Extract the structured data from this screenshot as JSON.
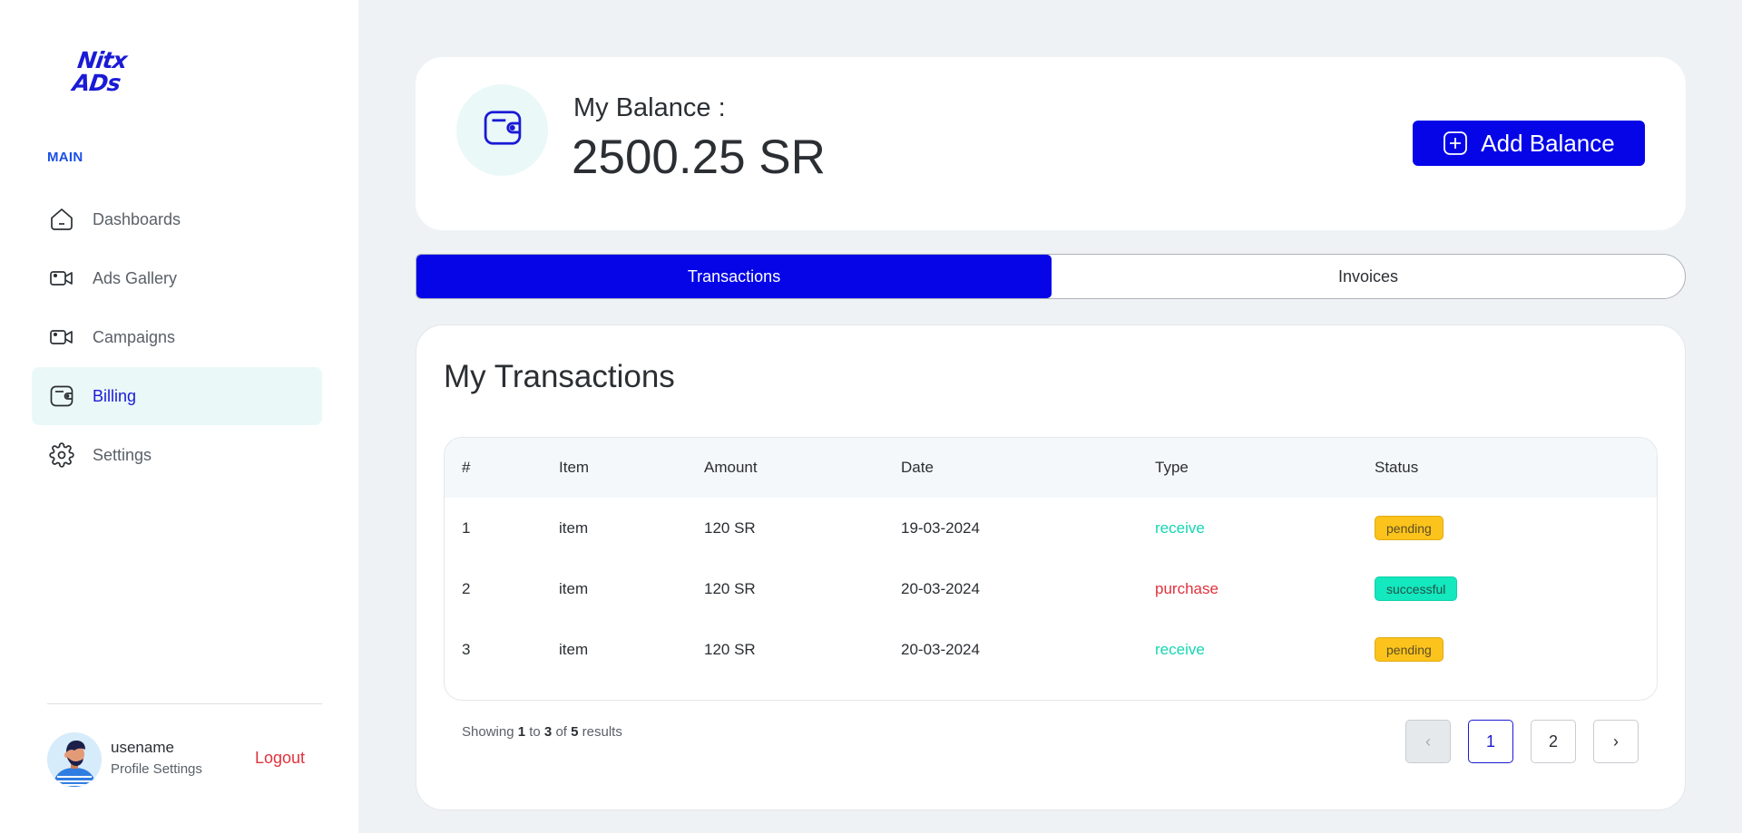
{
  "brand": {
    "logo_line1": "Nitx",
    "logo_line2": "ADs",
    "color": "#1a1ad6"
  },
  "sidebar": {
    "section_label": "MAIN",
    "items": [
      {
        "label": "Dashboards",
        "icon": "home-icon",
        "active": false
      },
      {
        "label": "Ads Gallery",
        "icon": "video-icon",
        "active": false
      },
      {
        "label": "Campaigns",
        "icon": "video-icon",
        "active": false
      },
      {
        "label": "Billing",
        "icon": "wallet-icon",
        "active": true
      },
      {
        "label": "Settings",
        "icon": "gear-icon",
        "active": false
      }
    ],
    "user": {
      "name": "usename",
      "sub_link": "Profile Settings",
      "logout": "Logout"
    }
  },
  "balance": {
    "label": "My Balance :",
    "value": "2500.25 SR",
    "add_button": "Add Balance"
  },
  "tabs": [
    {
      "label": "Transactions",
      "active": true
    },
    {
      "label": "Invoices",
      "active": false
    }
  ],
  "transactions": {
    "title": "My Transactions",
    "columns": [
      "#",
      "Item",
      "Amount",
      "Date",
      "Type",
      "Status"
    ],
    "rows": [
      {
        "idx": "1",
        "item": "item",
        "amount": "120 SR",
        "date": "19-03-2024",
        "type": "receive",
        "status": "pending"
      },
      {
        "idx": "2",
        "item": "item",
        "amount": "120 SR",
        "date": "20-03-2024",
        "type": "purchase",
        "status": "successful"
      },
      {
        "idx": "3",
        "item": "item",
        "amount": "120 SR",
        "date": "20-03-2024",
        "type": "receive",
        "status": "pending"
      }
    ],
    "footer": {
      "prefix": "Showing",
      "from": "1",
      "to_word": "to",
      "to": "3",
      "of_word": "of",
      "total": "5",
      "suffix": "results"
    },
    "pagination": {
      "prev": "‹",
      "pages": [
        "1",
        "2"
      ],
      "current": "1",
      "next": "›"
    }
  },
  "colors": {
    "accent": "#0505e8",
    "receive": "#14d6b3",
    "purchase": "#e0323c",
    "pending": "#fbc31b",
    "successful": "#13e8be",
    "logout": "#e0323c"
  }
}
